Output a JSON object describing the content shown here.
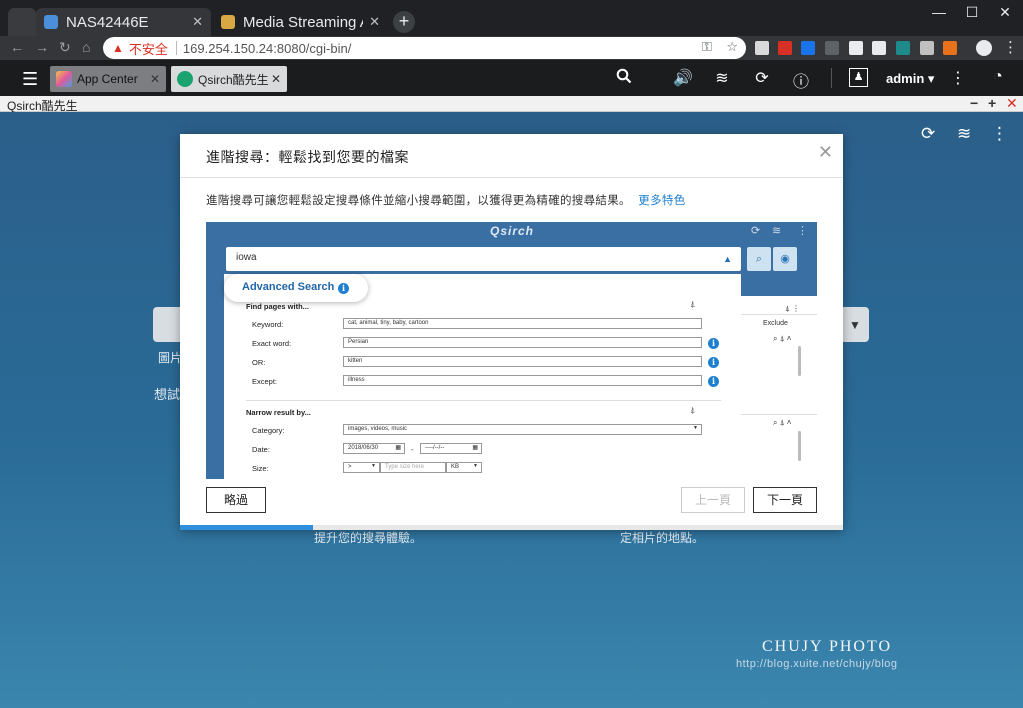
{
  "browser": {
    "tabs": [
      {
        "title": "NAS42446E",
        "favicon_color": "#4a8fd8"
      },
      {
        "title": "Media Streaming A",
        "favicon_color": "#d8a845"
      }
    ],
    "new_tab": "+",
    "window_controls": {
      "minimize": "—",
      "maximize": "☐",
      "close": "✕"
    },
    "nav": {
      "back": "←",
      "forward": "→",
      "reload": "↻",
      "home": "⌂"
    },
    "address": {
      "security_label": "不安全",
      "url": "169.254.150.24:8080/cgi-bin/"
    },
    "omni_icons": {
      "key": "⚿",
      "star": "☆"
    },
    "extension_colors": [
      "#d9d9d9",
      "#d93025",
      "#1a73e8",
      "#5f6368",
      "#e8eaed",
      "#e8eaed",
      "#1e8a8a",
      "#c0c0c0",
      "#e8711c"
    ]
  },
  "qts": {
    "hamburger": "☰",
    "tabs": [
      {
        "label": "App Center",
        "close": "✕"
      },
      {
        "label": "Qsirch酷先生",
        "close": "✕"
      }
    ],
    "toolbar_icons": {
      "search": "🔍",
      "volume": "🔊",
      "stack": "≋",
      "sync": "⟳",
      "info": "ⓘ",
      "user": "👤",
      "more": "⋮",
      "dashboard": "◔"
    },
    "user": "admin ▾"
  },
  "window": {
    "title": "Qsirch酷先生",
    "controls": {
      "minimize": "−",
      "maximize": "+",
      "close": "✕"
    }
  },
  "app": {
    "icons": {
      "refresh": "⟳",
      "stack": "≋",
      "more": "⋮"
    },
    "bg_texts": {
      "left_label": "圖片",
      "left_line": "想試",
      "bottom_left": "提升您的搜尋體驗。",
      "bottom_right": "定相片的地點。"
    },
    "watermark": {
      "title": "CHUJY PHOTO",
      "url": "http://blog.xuite.net/chujy/blog"
    }
  },
  "modal": {
    "title": "進階搜尋：輕鬆找到您要的檔案",
    "close": "✕",
    "description": "進階搜尋可讓您輕鬆設定搜尋條件並縮小搜尋範圍，以獲得更為精確的搜尋結果。",
    "more_link": "更多特色",
    "screenshot": {
      "logo": "Qsirch",
      "search_value": "iowa",
      "badge_label": "Advanced Search",
      "find_section": "Find pages with...",
      "fields": [
        {
          "label": "Keyword:",
          "value": "cat, animal, tiny, baby, cartoon"
        },
        {
          "label": "Exact word:",
          "value": "Persian"
        },
        {
          "label": "OR:",
          "value": "kitten"
        },
        {
          "label": "Except:",
          "value": "illness"
        }
      ],
      "narrow_section": "Narrow result by...",
      "category_label": "Category:",
      "category_value": "images, videos, music",
      "date_label": "Date:",
      "date_from": "2018/06/30",
      "date_sep": "-",
      "date_to": "----/--/--",
      "size_label": "Size:",
      "size_op": ">",
      "size_placeholder": "Type size here",
      "size_unit": "KB",
      "exclude_label": "Exclude"
    },
    "skip_button": "略過",
    "prev_button": "上一頁",
    "next_button": "下一頁",
    "progress": 0.2
  }
}
